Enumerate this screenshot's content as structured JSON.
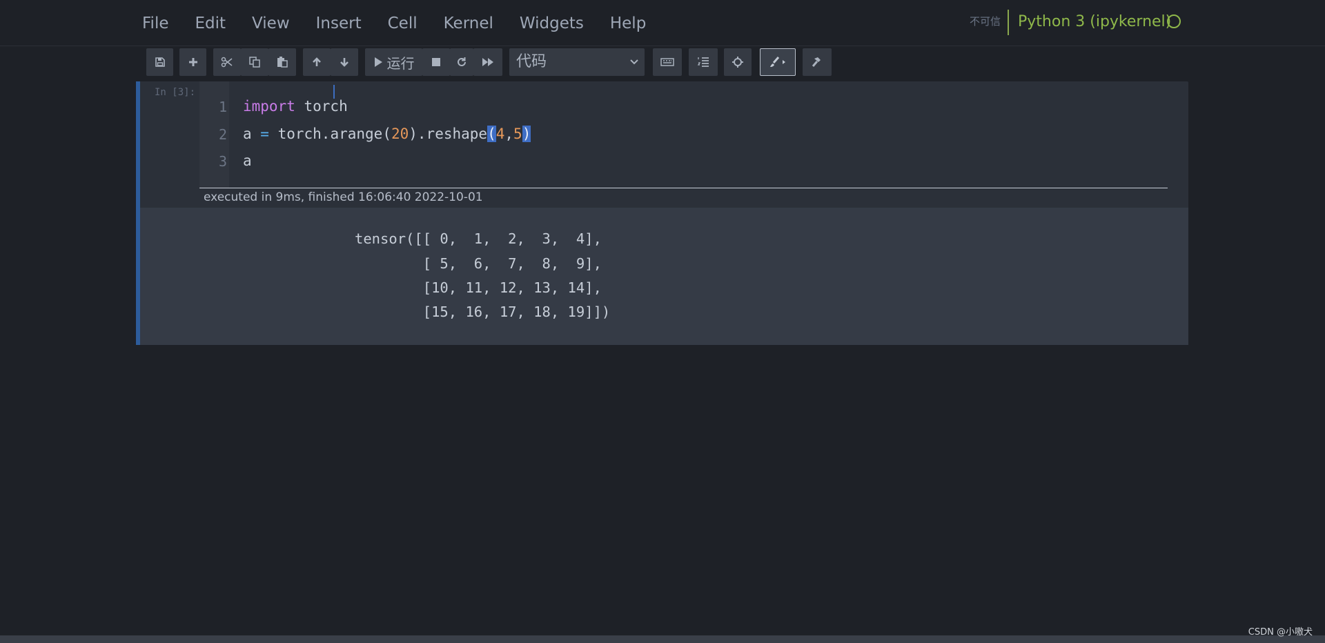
{
  "menu": {
    "items": [
      "File",
      "Edit",
      "View",
      "Insert",
      "Cell",
      "Kernel",
      "Widgets",
      "Help"
    ]
  },
  "header": {
    "trust_label": "不可信",
    "kernel_name": "Python 3 (ipykernel)"
  },
  "toolbar": {
    "run_label": "运行",
    "cell_type": "代码",
    "icons": [
      "save-icon",
      "plus-icon",
      "scissors-icon",
      "copy-icon",
      "paste-icon",
      "arrow-up-icon",
      "arrow-down-icon",
      "play-icon",
      "stop-icon",
      "restart-icon",
      "fast-forward-icon",
      "keyboard-icon",
      "list-icon",
      "crosshair-icon",
      "brush-icon",
      "hammer-icon"
    ]
  },
  "cell": {
    "prompt": "In [3]:",
    "line_numbers": [
      "1",
      "2",
      "3"
    ],
    "code": {
      "line1_kw": "import",
      "line1_rest": " torch",
      "line2_var": "a ",
      "line2_op": "=",
      "line2_call": " torch.arange(",
      "line2_arg": "20",
      "line2_mid": ").reshape",
      "line2_open": "(",
      "line2_a": "4",
      "line2_comma": ",",
      "line2_b": "5",
      "line2_close": ")",
      "line3": "a"
    },
    "exec_info": "executed in 9ms, finished 16:06:40 2022-10-01",
    "output": [
      "tensor([[ 0,  1,  2,  3,  4],",
      "        [ 5,  6,  7,  8,  9],",
      "        [10, 11, 12, 13, 14],",
      "        [15, 16, 17, 18, 19]])"
    ]
  },
  "watermark": "CSDN @小嗷犬",
  "colors": {
    "background": "#1e2127",
    "kernel_green": "#8fb84a",
    "cell_accent": "#2d5c9b",
    "keyword": "#c97ce8",
    "number": "#e6985a",
    "operator": "#59b2f0"
  }
}
